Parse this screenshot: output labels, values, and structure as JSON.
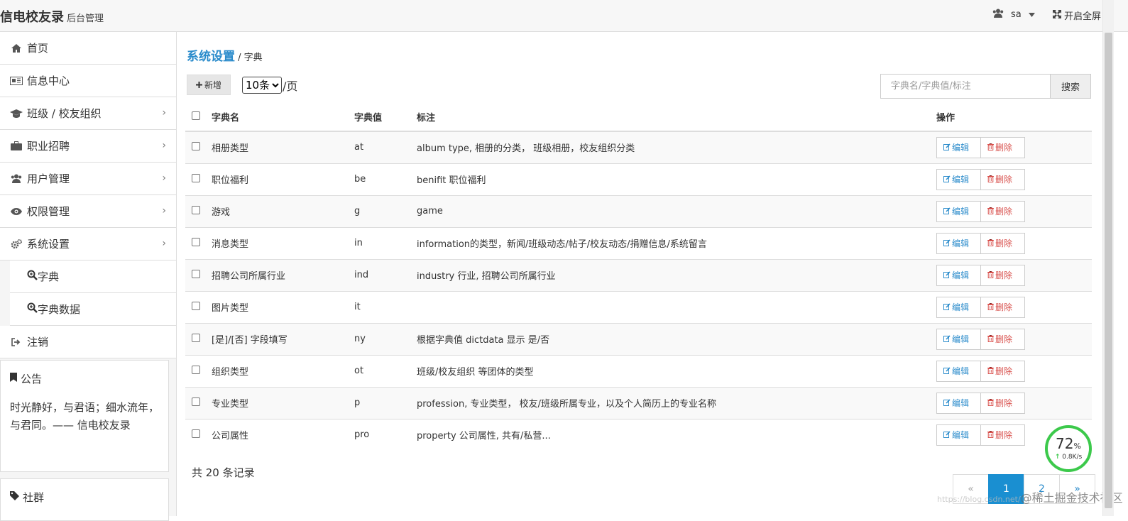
{
  "header": {
    "brand": "信电校友录",
    "subtitle": "后台管理",
    "user": "sa",
    "fullscreen_label": "开启全屏"
  },
  "sidebar": {
    "items": [
      {
        "label": "首页",
        "icon": "home-icon"
      },
      {
        "label": "信息中心",
        "icon": "newspaper-icon"
      },
      {
        "label": "班级 / 校友组织",
        "icon": "graduation-cap-icon"
      },
      {
        "label": "职业招聘",
        "icon": "briefcase-icon"
      },
      {
        "label": "用户管理",
        "icon": "users-icon"
      },
      {
        "label": "权限管理",
        "icon": "eye-icon"
      },
      {
        "label": "系统设置",
        "icon": "cogs-icon"
      }
    ],
    "sub_items": [
      {
        "label": "字典",
        "icon": "search-plus-icon"
      },
      {
        "label": "字典数据",
        "icon": "search-plus-icon"
      }
    ],
    "logout": {
      "label": "注销",
      "icon": "sign-out-icon"
    },
    "notice": {
      "title": "公告",
      "body": "时光静好，与君语；细水流年，与君同。—— 信电校友录"
    },
    "community": {
      "title": "社群"
    }
  },
  "main": {
    "breadcrumb": {
      "parent": "系统设置",
      "separator": "/",
      "current": "字典"
    },
    "add_label": "新增",
    "page_size": "10条",
    "page_size_unit": "/页",
    "search_placeholder": "字典名/字典值/标注",
    "search_label": "搜索",
    "columns": [
      "字典名",
      "字典值",
      "标注",
      "操作"
    ],
    "edit_label": "编辑",
    "delete_label": "删除",
    "rows": [
      {
        "name": "相册类型",
        "value": "at",
        "note": "album type, 相册的分类， 班级相册，校友组织分类"
      },
      {
        "name": "职位福利",
        "value": "be",
        "note": "benifit 职位福利"
      },
      {
        "name": "游戏",
        "value": "g",
        "note": "game"
      },
      {
        "name": "消息类型",
        "value": "in",
        "note": "information的类型，新闻/班级动态/帖子/校友动态/捐赠信息/系统留言"
      },
      {
        "name": "招聘公司所属行业",
        "value": "ind",
        "note": "industry 行业, 招聘公司所属行业"
      },
      {
        "name": "图片类型",
        "value": "it",
        "note": ""
      },
      {
        "name": "[是]/[否] 字段填写",
        "value": "ny",
        "note": "根据字典值 dictdata 显示 是/否"
      },
      {
        "name": "组织类型",
        "value": "ot",
        "note": "班级/校友组织 等团体的类型"
      },
      {
        "name": "专业类型",
        "value": "p",
        "note": "profession, 专业类型， 校友/班级所属专业，以及个人简历上的专业名称"
      },
      {
        "name": "公司属性",
        "value": "pro",
        "note": "property 公司属性, 共有/私营..."
      }
    ],
    "total": "共 20 条记录",
    "pager": [
      "«",
      "1",
      "2",
      "»"
    ],
    "current_page": "1"
  },
  "speed_widget": {
    "percent": "72",
    "percent_unit": "%",
    "rate": "0.8K/s"
  },
  "watermark": {
    "faint": "https://blog.csdn.net/",
    "text": "@稀土掘金技术社区"
  },
  "colors": {
    "accent": "#2a8bcb",
    "danger": "#d9534f",
    "active_page": "#1a8fd1",
    "gauge": "#3cc94b"
  }
}
